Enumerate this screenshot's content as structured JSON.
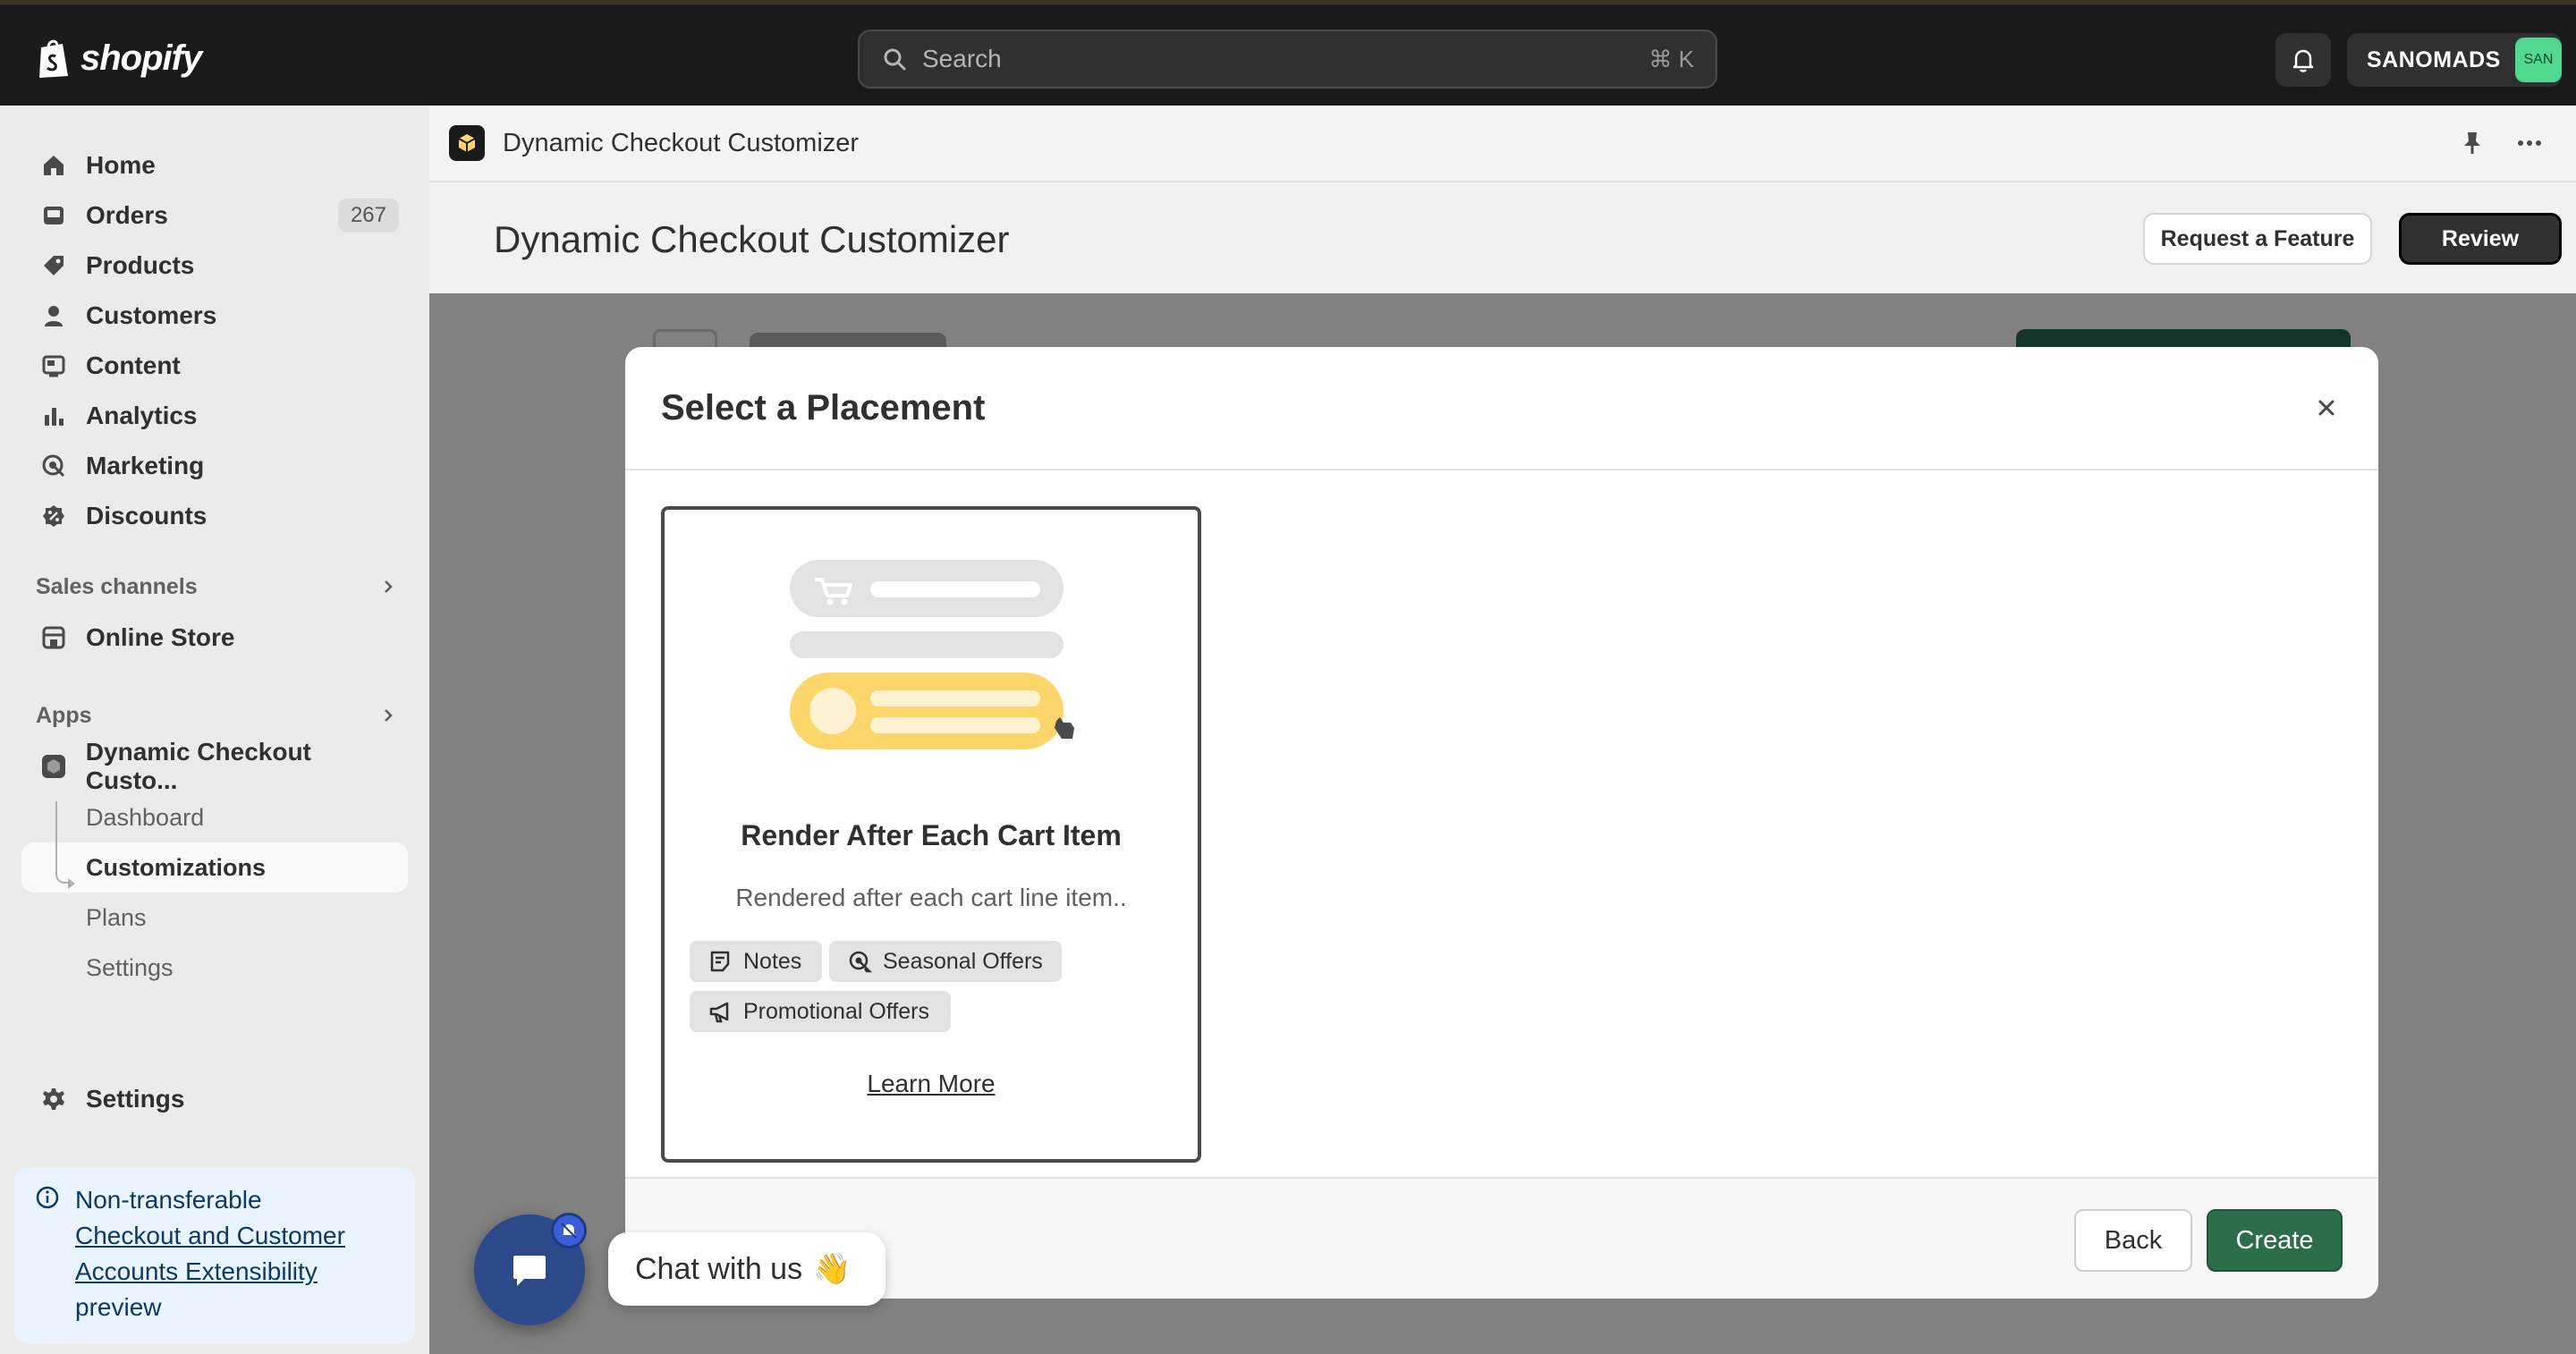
{
  "topbar": {
    "logo_text": "shopify",
    "search_placeholder": "Search",
    "search_shortcut": "⌘ K",
    "store_name": "SANOMADS",
    "store_avatar": "SAN"
  },
  "sidebar": {
    "items": [
      {
        "label": "Home",
        "icon": "home-icon"
      },
      {
        "label": "Orders",
        "icon": "orders-icon",
        "badge": "267"
      },
      {
        "label": "Products",
        "icon": "tag-icon"
      },
      {
        "label": "Customers",
        "icon": "person-icon"
      },
      {
        "label": "Content",
        "icon": "content-icon"
      },
      {
        "label": "Analytics",
        "icon": "bar-chart-icon"
      },
      {
        "label": "Marketing",
        "icon": "target-icon"
      },
      {
        "label": "Discounts",
        "icon": "discount-icon"
      }
    ],
    "sales_channels_label": "Sales channels",
    "online_store_label": "Online Store",
    "apps_label": "Apps",
    "app_name": "Dynamic Checkout Custo...",
    "app_subitems": [
      "Dashboard",
      "Customizations",
      "Plans",
      "Settings"
    ],
    "settings_label": "Settings",
    "notice": {
      "line1": "Non-transferable",
      "link": "Checkout and Customer Accounts Extensibility",
      "line3": "preview"
    }
  },
  "app_header": {
    "title": "Dynamic Checkout Customizer"
  },
  "page": {
    "title": "Dynamic Checkout Customizer",
    "request_feature_label": "Request a Feature",
    "review_label": "Review"
  },
  "modal": {
    "title": "Select a Placement",
    "card": {
      "title": "Render After Each Cart Item",
      "description": "Rendered after each cart line item..",
      "tags": [
        "Notes",
        "Seasonal Offers",
        "Promotional Offers"
      ],
      "learn_more": "Learn More"
    },
    "back_label": "Back",
    "create_label": "Create"
  },
  "chat": {
    "label": "Chat with us",
    "emoji": "👋"
  },
  "colors": {
    "brand_green": "#2c6e49",
    "topbar_bg": "#1a1a1a",
    "avatar_green": "#50d891",
    "illustration_yellow": "#fcd56b",
    "chat_blue": "#2c4a8a"
  }
}
